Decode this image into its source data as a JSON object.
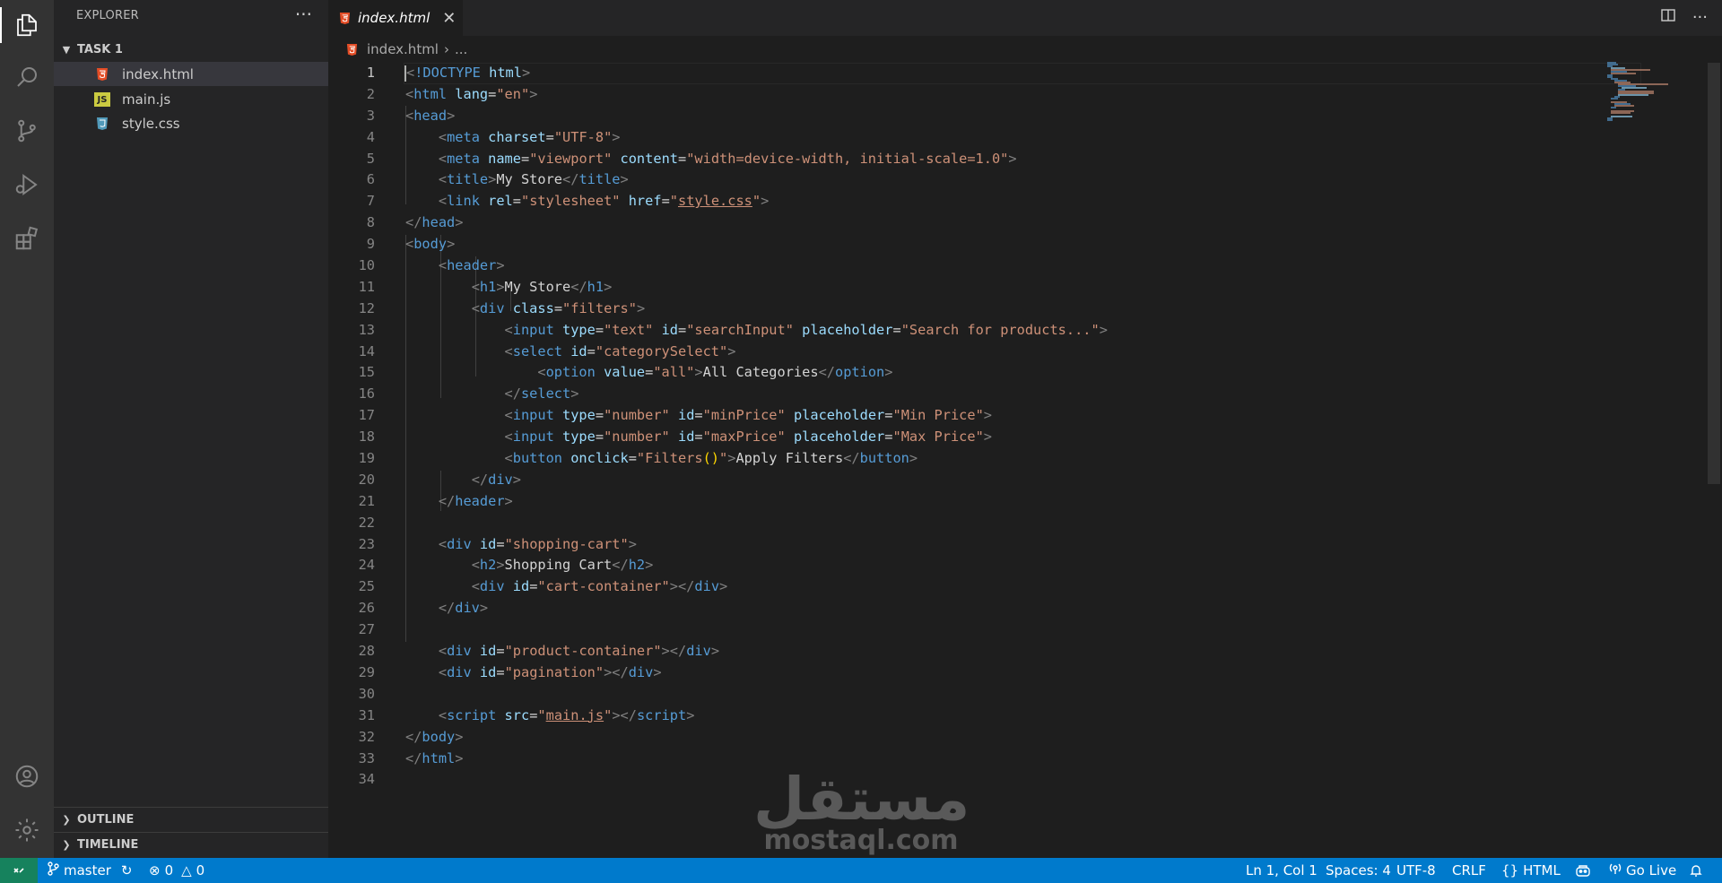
{
  "explorer": {
    "title": "EXPLORER",
    "more": "···",
    "folder": "TASK 1",
    "files": [
      {
        "name": "index.html",
        "icon": "html5-icon"
      },
      {
        "name": "main.js",
        "icon": "js-icon"
      },
      {
        "name": "style.css",
        "icon": "css3-icon"
      }
    ],
    "outline": "OUTLINE",
    "timeline": "TIMELINE"
  },
  "tab": {
    "label": "index.html",
    "close": "✕"
  },
  "breadcrumb": {
    "file": "index.html",
    "rest": "..."
  },
  "editor": {
    "line_numbers": [
      "1",
      "2",
      "3",
      "4",
      "5",
      "6",
      "7",
      "8",
      "9",
      "10",
      "11",
      "12",
      "13",
      "14",
      "15",
      "16",
      "17",
      "18",
      "19",
      "20",
      "21",
      "22",
      "23",
      "24",
      "25",
      "26",
      "27",
      "28",
      "29",
      "30",
      "31",
      "32",
      "33",
      "34"
    ],
    "current_line": 1
  },
  "status": {
    "branch": "master",
    "errors": "0",
    "warnings": "0",
    "position": "Ln 1, Col 1",
    "spaces": "Spaces: 4",
    "encoding": "UTF-8",
    "eol": "CRLF",
    "language": "HTML",
    "golive": "Go Live"
  },
  "watermark": {
    "arabic": "مستقل",
    "latin": "mostaql.com"
  },
  "colors": {
    "accent": "#007acc",
    "remote": "#16825d",
    "tag": "#569cd6",
    "attr": "#9cdcfe",
    "string": "#ce9178"
  }
}
